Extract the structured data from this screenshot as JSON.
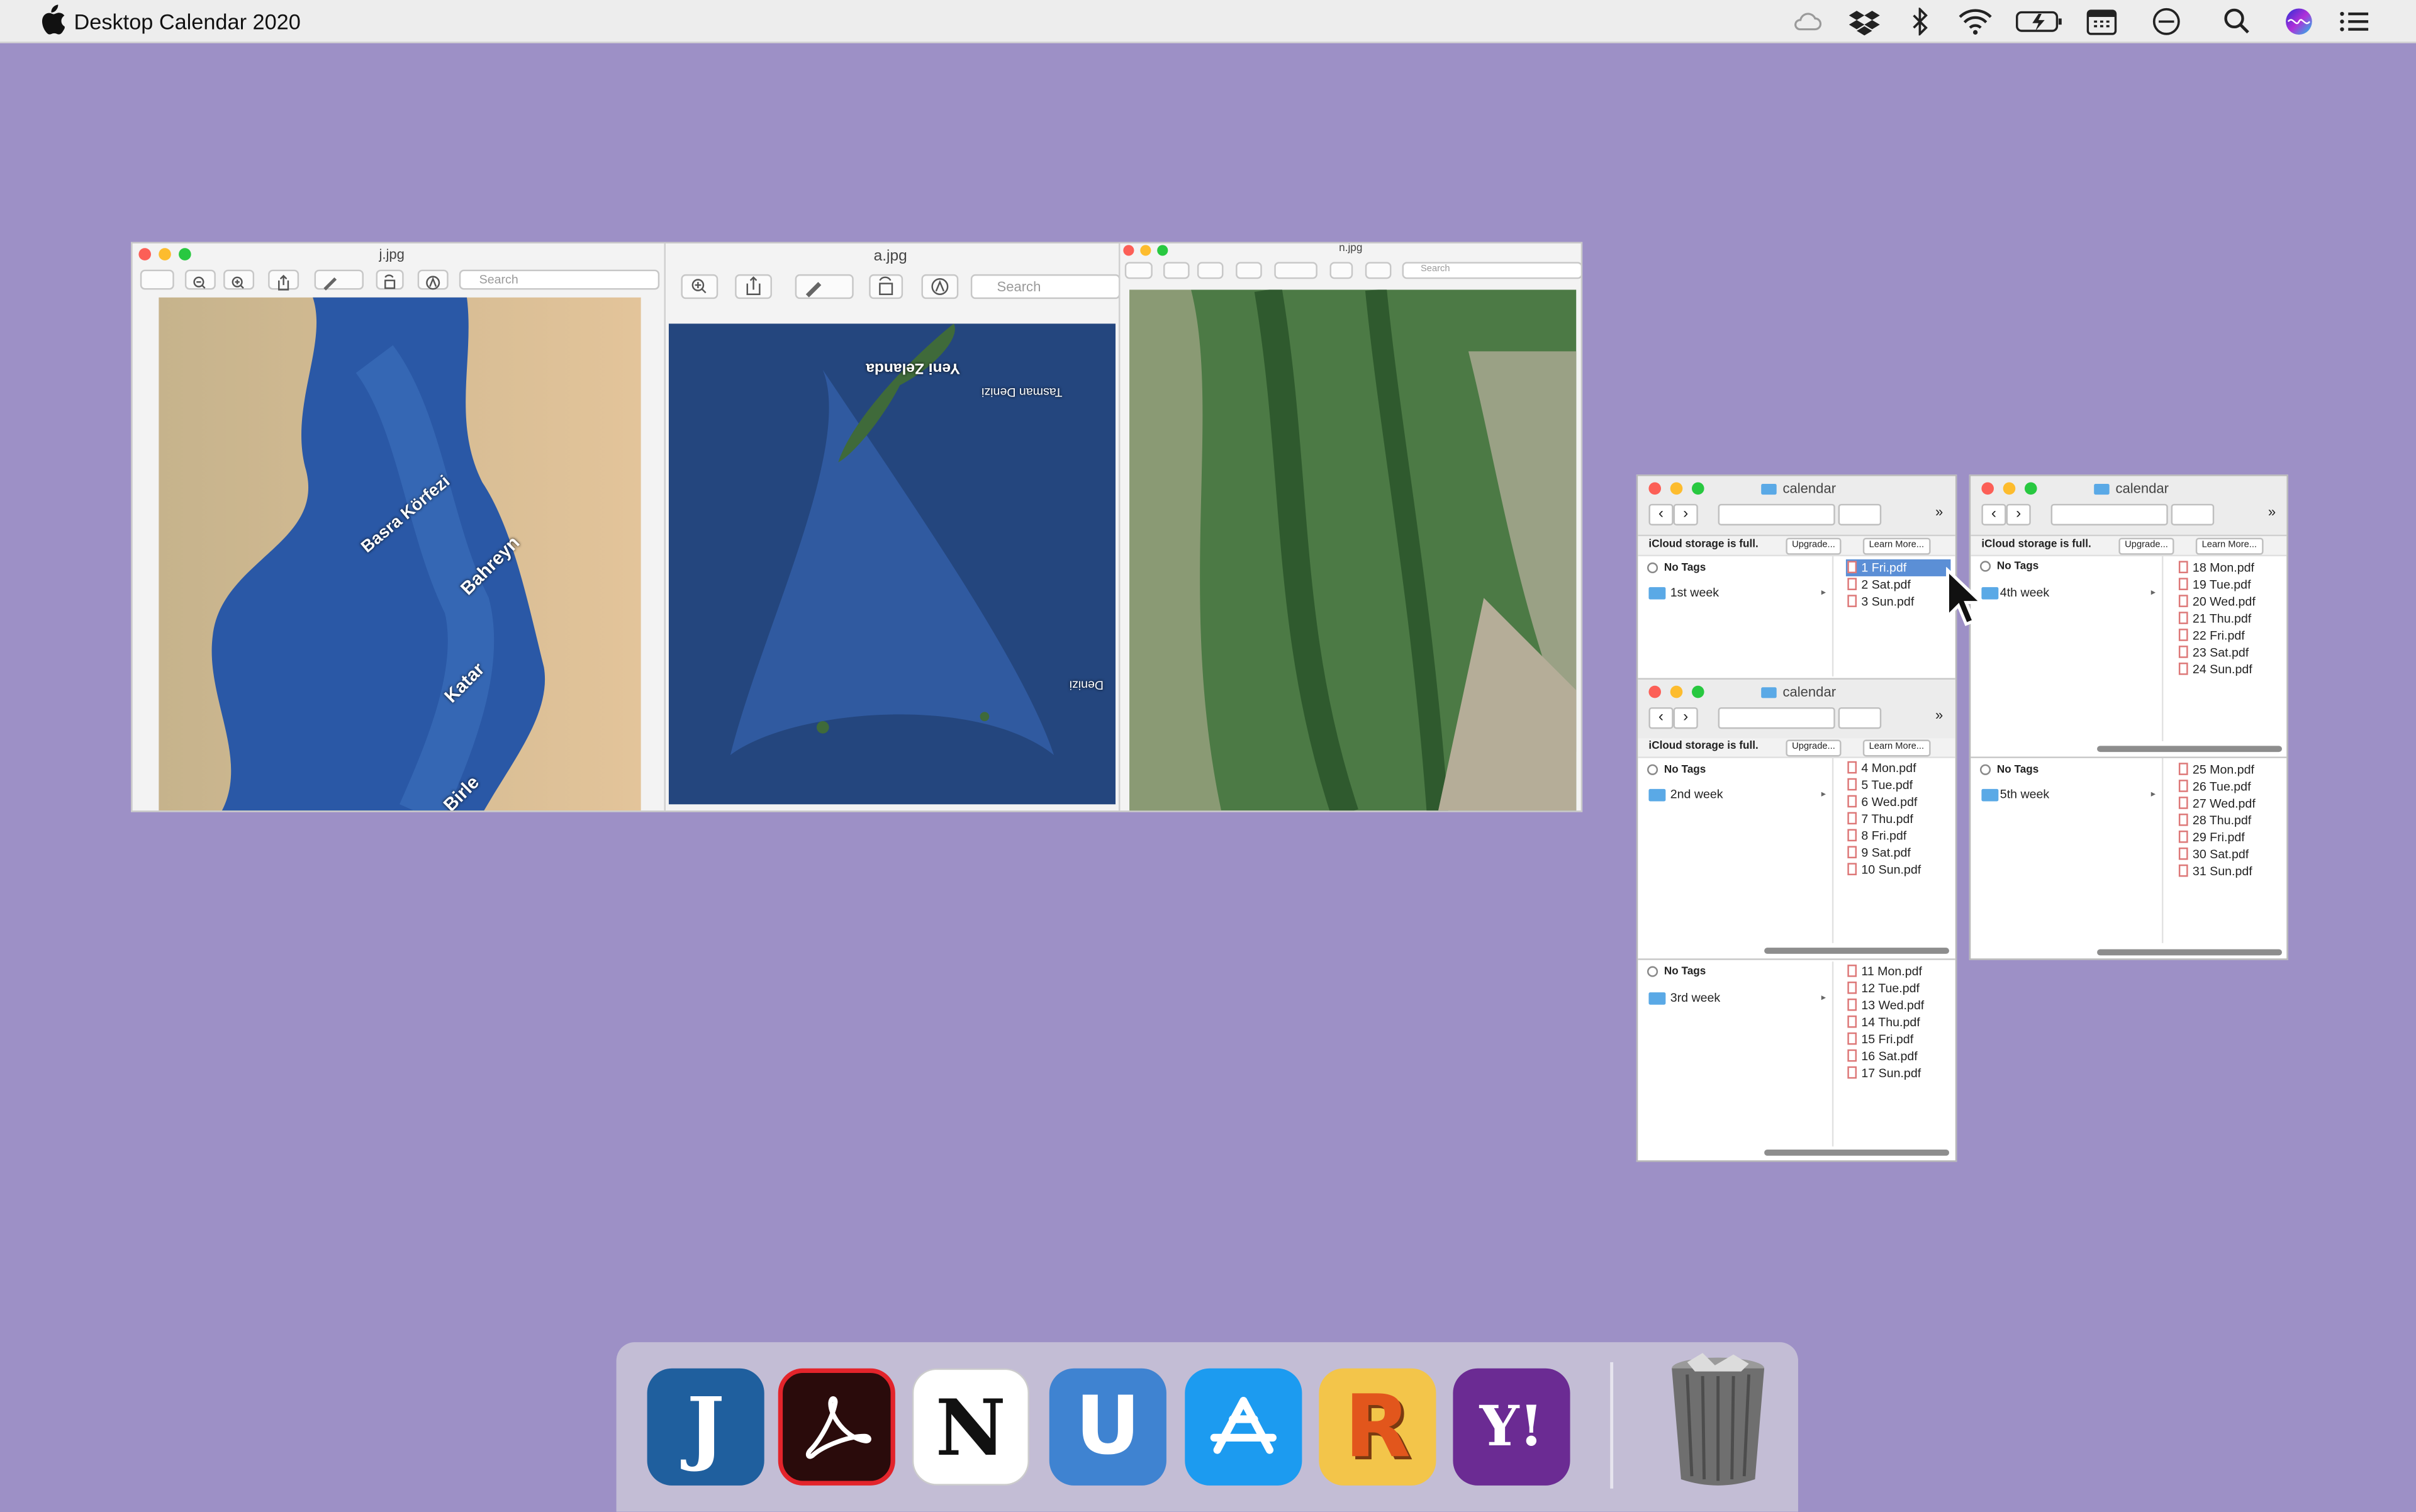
{
  "menubar": {
    "app_title": "Desktop Calendar 2020",
    "status_icons": [
      "icloud-icon",
      "dropbox-icon",
      "bluetooth-icon",
      "wifi-icon",
      "battery-charging-icon",
      "calendar-menubar-icon",
      "do-not-disturb-icon",
      "spotlight-search-icon",
      "siri-icon",
      "notification-center-icon"
    ]
  },
  "preview": {
    "window1": {
      "title": "j.jpg",
      "search_placeholder": "Search",
      "labels": [
        "Basra Körfezi",
        "Bahreyn",
        "Katar",
        "Birle"
      ]
    },
    "window2": {
      "title": "a.jpg",
      "search_placeholder": "Search",
      "labels": [
        "Yeni Zelanda",
        "Tasman Denizi",
        "Denizi"
      ]
    },
    "window3": {
      "title": "n.jpg",
      "search_placeholder": "Search"
    }
  },
  "finder": {
    "title": "calendar",
    "icloud_notice": "iCloud storage is full.",
    "upgrade_label": "Upgrade...",
    "learn_more_label": "Learn More...",
    "no_tags": "No Tags",
    "weeks": [
      {
        "folder": "1st week",
        "files": [
          "1 Fri.pdf",
          "2 Sat.pdf",
          "3 Sun.pdf"
        ]
      },
      {
        "folder": "2nd week",
        "files": [
          "4 Mon.pdf",
          "5 Tue.pdf",
          "6 Wed.pdf",
          "7 Thu.pdf",
          "8 Fri.pdf",
          "9 Sat.pdf",
          "10 Sun.pdf"
        ]
      },
      {
        "folder": "3rd week",
        "files": [
          "11 Mon.pdf",
          "12 Tue.pdf",
          "13 Wed.pdf",
          "14 Thu.pdf",
          "15 Fri.pdf",
          "16 Sat.pdf",
          "17 Sun.pdf"
        ]
      },
      {
        "folder": "4th week",
        "files": [
          "18 Mon.pdf",
          "19 Tue.pdf",
          "20 Wed.pdf",
          "21 Thu.pdf",
          "22 Fri.pdf",
          "23 Sat.pdf",
          "24 Sun.pdf"
        ]
      },
      {
        "folder": "5th week",
        "files": [
          "25 Mon.pdf",
          "26 Tue.pdf",
          "27 Wed.pdf",
          "28 Thu.pdf",
          "29 Fri.pdf",
          "30 Sat.pdf",
          "31 Sun.pdf"
        ]
      }
    ],
    "selected_file": "1 Fri.pdf"
  },
  "dock": {
    "apps": [
      {
        "name": "J",
        "icon": "jump-desktop-icon",
        "bg": "#1f5f9e"
      },
      {
        "name": "Acrobat",
        "icon": "adobe-acrobat-icon",
        "bg": "#2a0b0b"
      },
      {
        "name": "N",
        "icon": "notion-icon",
        "bg": "#ffffff"
      },
      {
        "name": "U",
        "icon": "ulysses-icon",
        "bg": "#3f83d1"
      },
      {
        "name": "App Store",
        "icon": "app-store-icon",
        "bg": "#1c9bf0"
      },
      {
        "name": "R",
        "icon": "r-app-icon",
        "bg": "#f3c54a"
      },
      {
        "name": "Y!",
        "icon": "yahoo-icon",
        "bg": "#6b2b93"
      }
    ],
    "trash": "trash-icon"
  },
  "colors": {
    "desktop": "#9d90c6",
    "selection": "#5b8fd6",
    "folder": "#5aa9e6"
  }
}
